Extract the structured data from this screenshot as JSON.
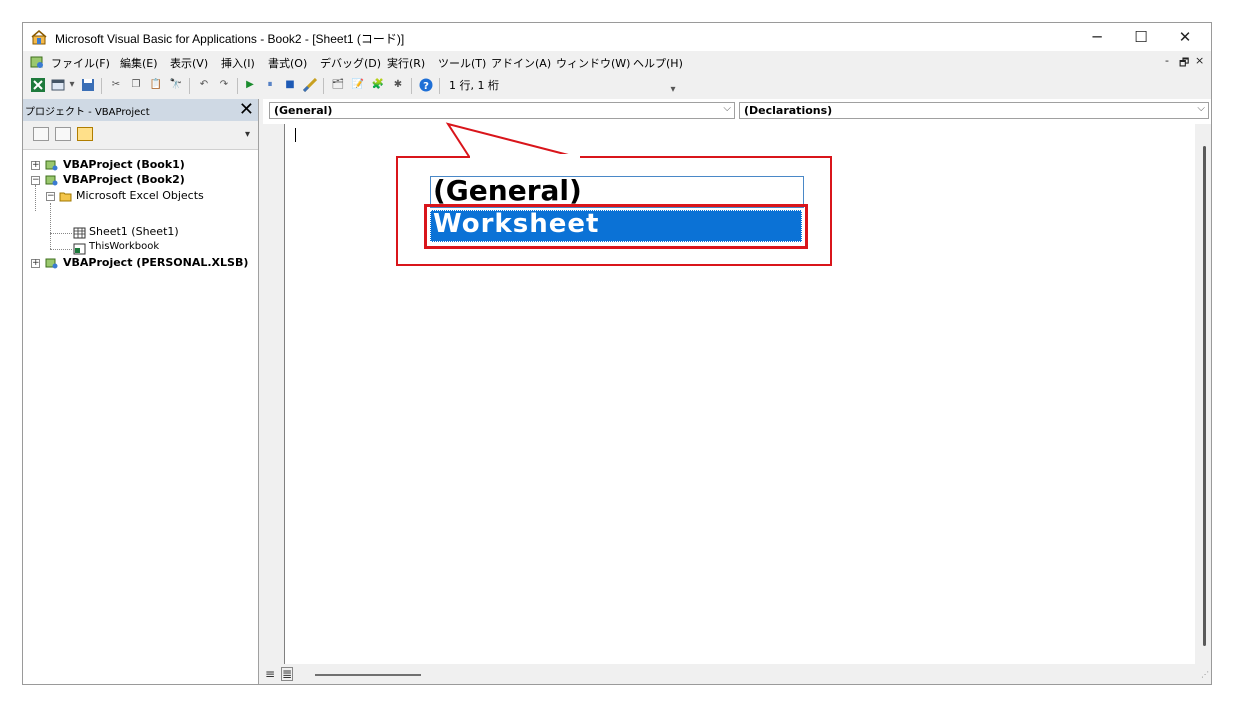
{
  "window": {
    "title": "Microsoft Visual Basic for Applications - Book2 - [Sheet1 (コード)]",
    "minimize_glyph": "─",
    "maximize_glyph": "☐",
    "close_glyph": "✕"
  },
  "menu": {
    "items": [
      "ファイル(F)",
      "編集(E)",
      "表示(V)",
      "挿入(I)",
      "書式(O)",
      "デバッグ(D)",
      "実行(R)",
      "ツール(T)",
      "アドイン(A)",
      "ウィンドウ(W)",
      "ヘルプ(H)"
    ],
    "mdi_minimize": "-",
    "mdi_restore": "🗗",
    "mdi_close": "×"
  },
  "toolbar": {
    "position_text": "1 行, 1 桁"
  },
  "project_pane": {
    "title": "プロジェクト - VBAProject",
    "close_glyph": "✕",
    "tree": {
      "book1": "VBAProject (Book1)",
      "book2": "VBAProject (Book2)",
      "excel_objects": "Microsoft Excel Objects",
      "sheet1": "Sheet1 (Sheet1)",
      "thisworkbook": "ThisWorkbook",
      "personal": "VBAProject (PERSONAL.XLSB)"
    }
  },
  "code_window": {
    "object_combo": "(General)",
    "procedure_combo": "(Declarations)"
  },
  "callout": {
    "general": "(General)",
    "worksheet": "Worksheet"
  },
  "colors": {
    "highlight_blue": "#0b72d6",
    "annotation_red": "#d9151b"
  },
  "icons": {
    "app": "vba-editor-icon",
    "project": "vbaproject-icon",
    "folder": "folder-icon",
    "sheet": "worksheet-icon",
    "workbook": "workbook-icon"
  }
}
